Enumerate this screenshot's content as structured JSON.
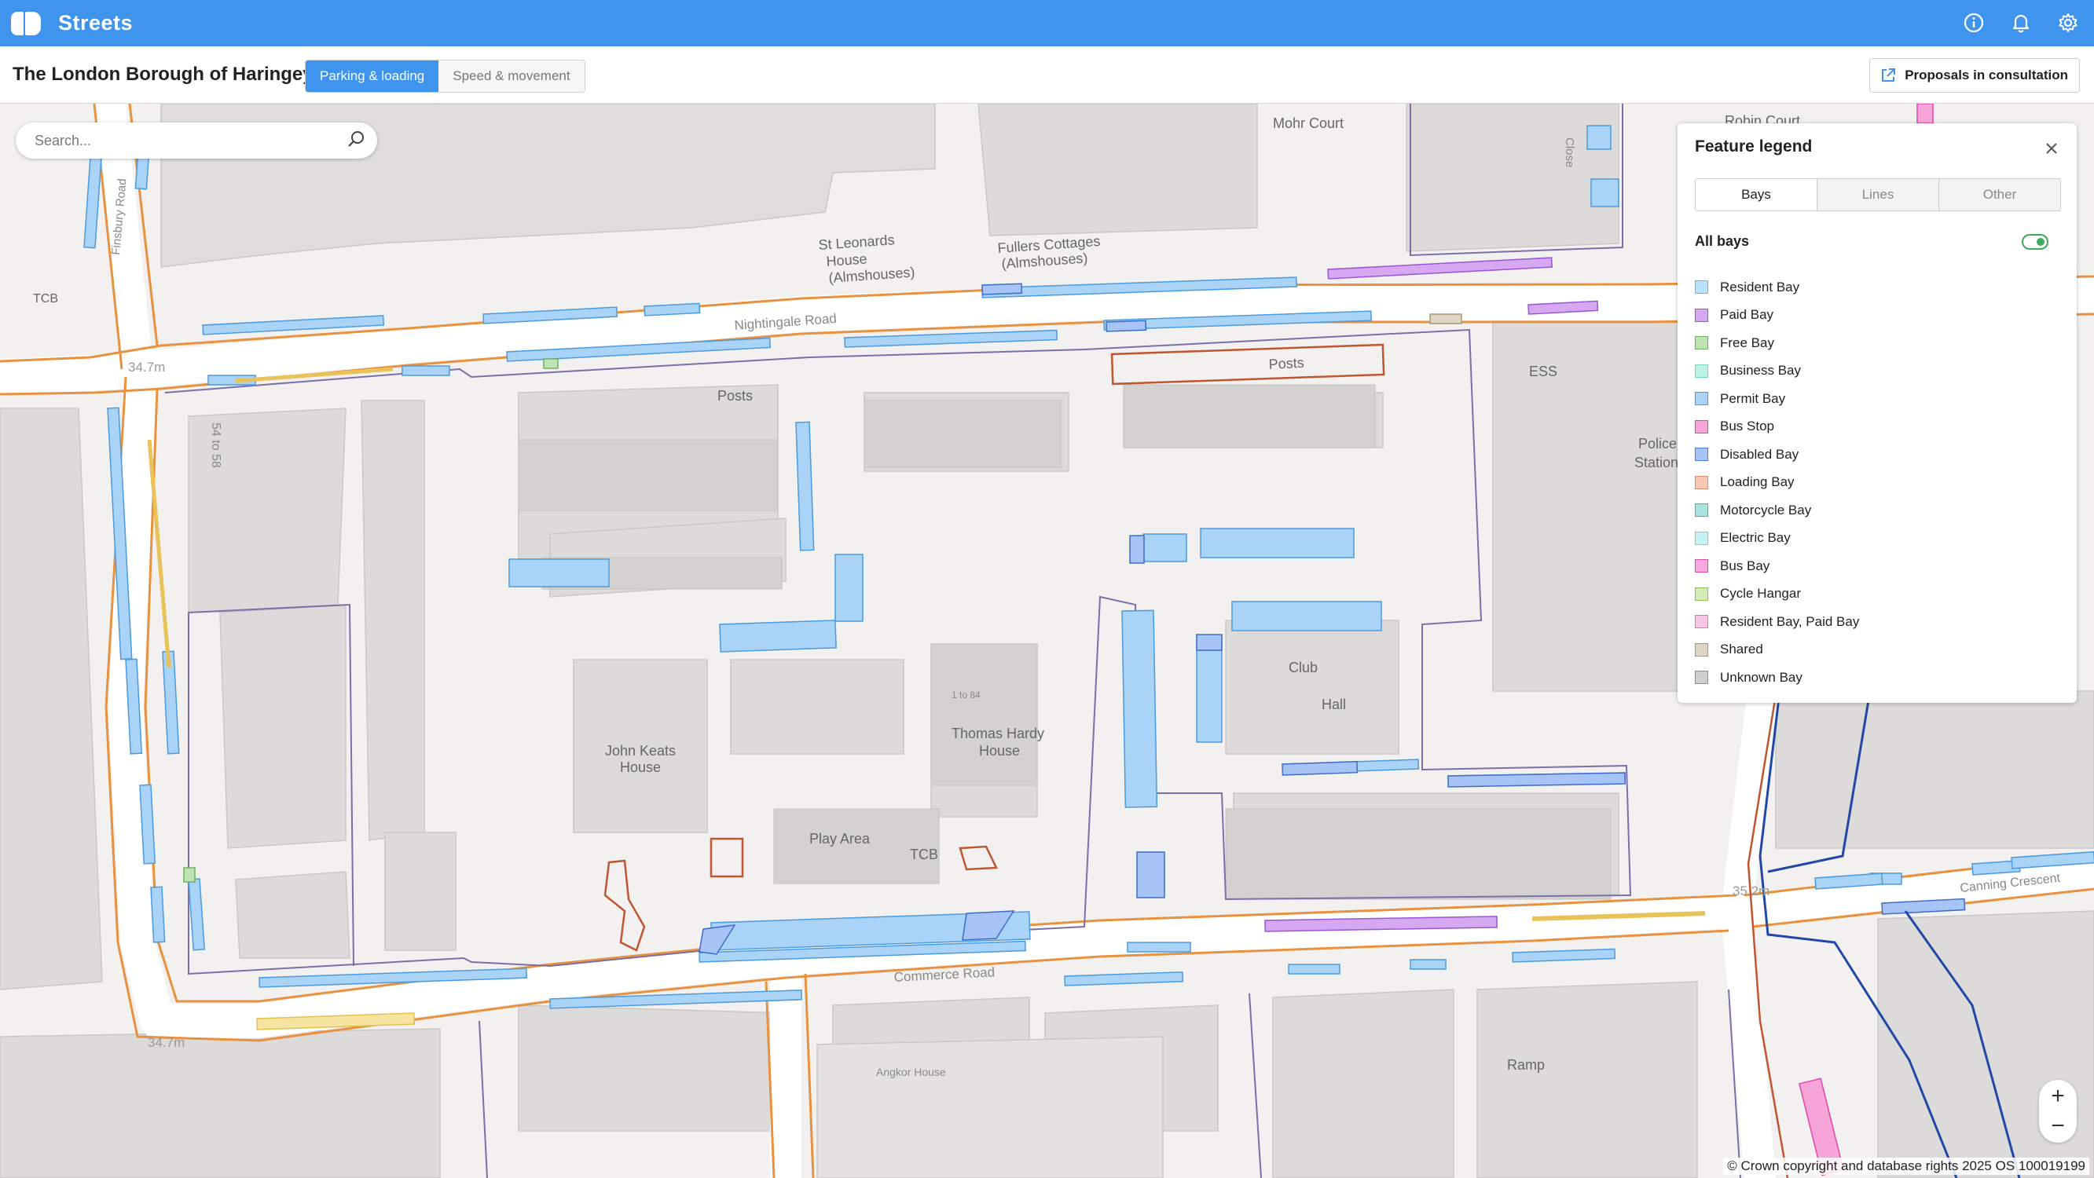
{
  "app": {
    "name": "Streets"
  },
  "header": {
    "borough": "The London Borough of Haringey",
    "tabs": [
      "Parking & loading",
      "Speed & movement"
    ],
    "active_tab": 0,
    "proposals_label": "Proposals in consultation"
  },
  "search": {
    "placeholder": "Search..."
  },
  "legend": {
    "title": "Feature legend",
    "tabs": [
      "Bays",
      "Lines",
      "Other"
    ],
    "active_tab": "Bays",
    "all_label": "All bays",
    "all_on": true,
    "items": [
      {
        "label": "Resident Bay",
        "fill": "#b7e2fa",
        "stroke": "#64b5ea"
      },
      {
        "label": "Paid Bay",
        "fill": "#d6a8f2",
        "stroke": "#9a55d6"
      },
      {
        "label": "Free Bay",
        "fill": "#bfe3b4",
        "stroke": "#6ab35e"
      },
      {
        "label": "Business Bay",
        "fill": "#bdf3e6",
        "stroke": "#6fd8bf"
      },
      {
        "label": "Permit Bay",
        "fill": "#a9d3f7",
        "stroke": "#4a9be0"
      },
      {
        "label": "Bus Stop",
        "fill": "#f7a5d8",
        "stroke": "#e046ad"
      },
      {
        "label": "Disabled Bay",
        "fill": "#a8c3f5",
        "stroke": "#4a7ee0"
      },
      {
        "label": "Loading Bay",
        "fill": "#f8c8b4",
        "stroke": "#e38b66"
      },
      {
        "label": "Motorcycle Bay",
        "fill": "#a9e3dd",
        "stroke": "#45b3a8"
      },
      {
        "label": "Electric Bay",
        "fill": "#c7f2f5",
        "stroke": "#72d2dd"
      },
      {
        "label": "Bus Bay",
        "fill": "#f7a8de",
        "stroke": "#e04aa9"
      },
      {
        "label": "Cycle Hangar",
        "fill": "#d3eab6",
        "stroke": "#8cc25a"
      },
      {
        "label": "Resident Bay, Paid Bay",
        "fill": "#f6c6e3",
        "stroke": "#d77ab7"
      },
      {
        "label": "Shared",
        "fill": "#ddd5c2",
        "stroke": "#a59978"
      },
      {
        "label": "Unknown Bay",
        "fill": "#cfcfcf",
        "stroke": "#8c8c8c"
      }
    ]
  },
  "map_labels": {
    "streets": [
      "Nightingale Road",
      "Commerce Road",
      "Canning Crescent",
      "Finsbury Road",
      "Close"
    ],
    "places": [
      "St Leonards House (Almshouses)",
      "Fullers Cottages (Almshouses)",
      "Mohr Court",
      "Robin Court",
      "John Keats House",
      "Thomas Hardy House",
      "Play Area",
      "Club Hall",
      "Police Station",
      "Angkor House",
      "Ramp",
      "Posts",
      "Posts",
      "TCB",
      "TCB",
      "ESS",
      "1 to 84",
      "54 to 58"
    ],
    "spot_heights": [
      "34.7m",
      "34.7m",
      "35.2m"
    ]
  },
  "map": {
    "zoom_in": "+",
    "zoom_out": "−",
    "copyright": "© Crown copyright and database rights 2025 OS 100019199"
  },
  "icons": {
    "brand": "streets-logo-icon",
    "info": "info-icon",
    "notifications": "bell-icon",
    "settings": "gear-icon",
    "search": "search-icon",
    "external": "external-link-icon",
    "close": "close-icon"
  },
  "colors": {
    "brand_blue": "#3f95ee",
    "road_edge": "#e8923f",
    "boundary": "#7b6fa8",
    "restriction_red": "#c0552f",
    "route_blue": "#2147a8"
  }
}
